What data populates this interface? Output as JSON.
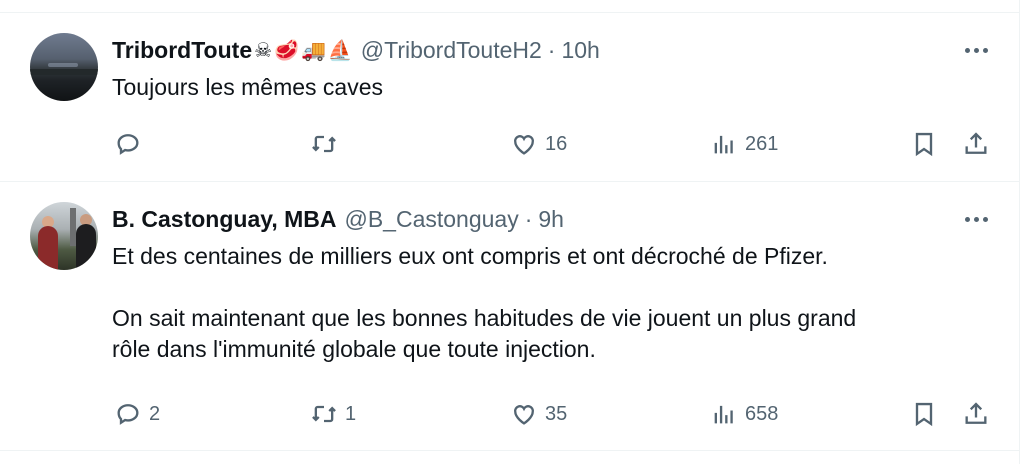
{
  "tweets": [
    {
      "name": "TribordToute",
      "emojis": [
        "☠",
        "🥩",
        "🚚",
        "⛵"
      ],
      "handle": "@TribordTouteH2",
      "separator": "·",
      "time": "10h",
      "text": [
        "Toujours les mêmes caves"
      ],
      "replies": "",
      "retweets": "",
      "likes": "16",
      "views": "261"
    },
    {
      "name": "B. Castonguay, MBA",
      "emojis": [],
      "handle": "@B_Castonguay",
      "separator": "·",
      "time": "9h",
      "text": [
        "Et des centaines de milliers eux ont compris et ont décroché de Pfizer.",
        "",
        "On sait maintenant que les bonnes habitudes de vie jouent un plus grand",
        "rôle dans l'immunité globale que toute injection."
      ],
      "replies": "2",
      "retweets": "1",
      "likes": "35",
      "views": "658"
    }
  ],
  "icons": {
    "reply": "reply-icon",
    "retweet": "retweet-icon",
    "like": "heart-icon",
    "views": "views-chart-icon",
    "bookmark": "bookmark-icon",
    "share": "share-icon",
    "more": "more-options-icon"
  },
  "colors": {
    "text": "#0f1419",
    "secondary": "#536471",
    "border": "#eff3f4"
  }
}
